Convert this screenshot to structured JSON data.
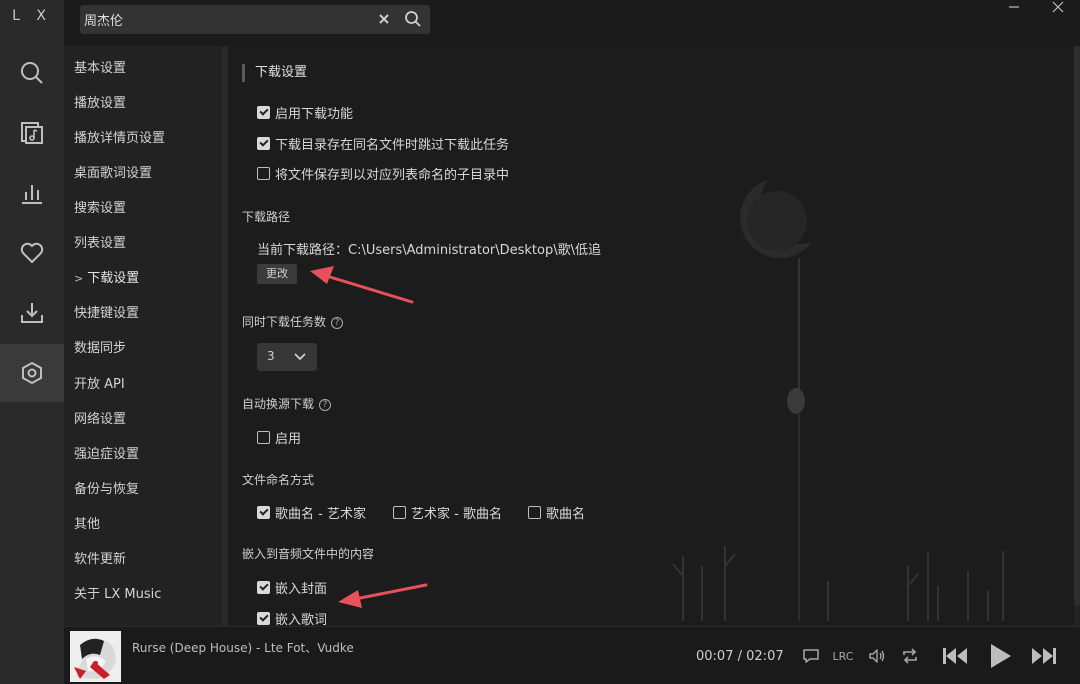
{
  "app": {
    "logo": "L X"
  },
  "search": {
    "value": "周杰伦",
    "placeholder": ""
  },
  "window": {
    "minimize_icon": "minimize-icon",
    "close_icon": "close-icon"
  },
  "rail": [
    "search-icon",
    "music-list-icon",
    "leaderboard-icon",
    "heart-icon",
    "download-icon",
    "settings-icon"
  ],
  "nav": {
    "active_marker": ">",
    "items": [
      "基本设置",
      "播放设置",
      "播放详情页设置",
      "桌面歌词设置",
      "搜索设置",
      "列表设置",
      "下载设置",
      "快捷键设置",
      "数据同步",
      "开放 API",
      "网络设置",
      "强迫症设置",
      "备份与恢复",
      "其他",
      "软件更新",
      "关于 LX Music"
    ]
  },
  "download": {
    "section_title": "下载设置",
    "enable": "启用下载功能",
    "skip_same_name": "下载目录存在同名文件时跳过下载此任务",
    "save_sub_dir": "将文件保存到以对应列表命名的子目录中",
    "path_title": "下载路径",
    "path_text": "当前下载路径：C:\\Users\\Administrator\\Desktop\\歌\\低追",
    "change_button": "更改",
    "concurrent_title": "同时下载任务数",
    "concurrent_value": "3",
    "auto_switch_title": "自动换源下载",
    "auto_switch_enable": "启用",
    "naming_title": "文件命名方式",
    "naming_options": [
      "歌曲名 - 艺术家",
      "艺术家 - 歌曲名",
      "歌曲名"
    ],
    "embed_title": "嵌入到音频文件中的内容",
    "embed_cover": "嵌入封面",
    "embed_lyric": "嵌入歌词",
    "help_mark": "?"
  },
  "player": {
    "song": "Rurse (Deep House) - Lte Fot、Vudke",
    "current_time": "00:07",
    "time_separator": "/",
    "total_time": "02:07",
    "lrc_label": "LRC"
  },
  "colors": {
    "annotation_arrow": "#e8505b",
    "background": "#1c1c1c",
    "accent": "#d9d9d9"
  }
}
